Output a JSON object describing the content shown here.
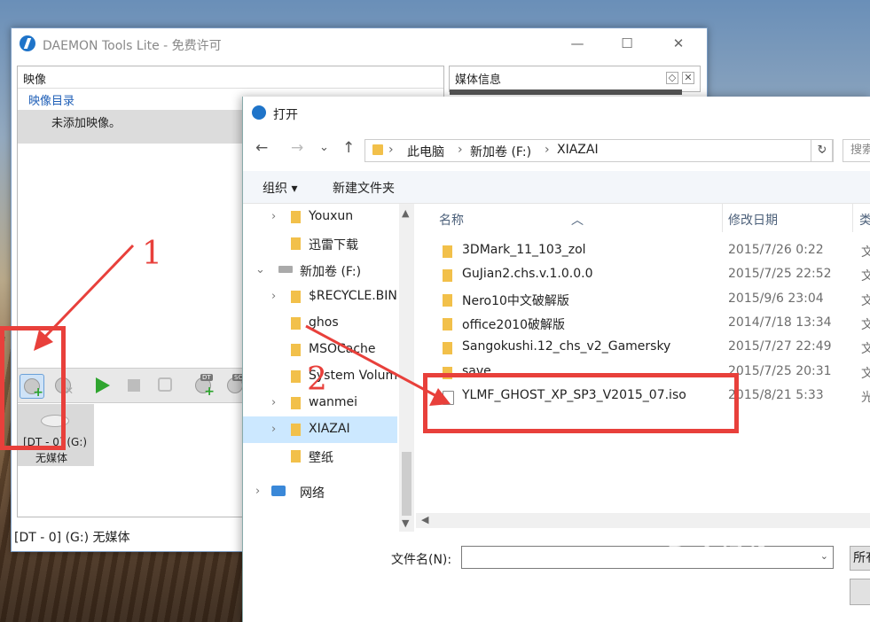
{
  "daemon": {
    "title": "DAEMON Tools Lite - 免费许可",
    "controls": {
      "minimize": "—",
      "maximize": "☐",
      "close": "✕"
    },
    "images_panel": {
      "header": "映像",
      "category": "映像目录",
      "empty_text": "未添加映像。"
    },
    "media_panel": {
      "header": "媒体信息"
    },
    "toolbar": {
      "dt_badge": "DT",
      "scsi_badge": "SCSI"
    },
    "drive": {
      "line1": "[DT - 0]  (G:)",
      "line2": "无媒体"
    },
    "status": "[DT - 0] (G:) 无媒体"
  },
  "open_dialog": {
    "title": "打开",
    "nav": {
      "back": "←",
      "forward": "→",
      "recent": "⌄",
      "up": "↑"
    },
    "breadcrumb": [
      "此电脑",
      "新加卷 (F:)",
      "XIAZAI"
    ],
    "search_placeholder": "搜索",
    "commands": {
      "organize": "组织 ▾",
      "new_folder": "新建文件夹"
    },
    "tree": [
      {
        "label": "Youxun",
        "expandable": true
      },
      {
        "label": "迅雷下载",
        "expandable": false
      },
      {
        "label": "新加卷 (F:)",
        "expandable": true,
        "expanded": true,
        "drive": true
      },
      {
        "label": "$RECYCLE.BIN",
        "expandable": true
      },
      {
        "label": "ghos",
        "expandable": false
      },
      {
        "label": "MSOCache",
        "expandable": false
      },
      {
        "label": "System Volum",
        "expandable": false
      },
      {
        "label": "wanmei",
        "expandable": true
      },
      {
        "label": "XIAZAI",
        "expandable": true,
        "selected": true
      },
      {
        "label": "壁纸",
        "expandable": false
      },
      {
        "label": "网络",
        "expandable": true,
        "network": true
      }
    ],
    "columns": {
      "name": "名称",
      "date": "修改日期",
      "type": "类"
    },
    "files": [
      {
        "name": "3DMark_11_103_zol",
        "date": "2015/7/26 0:22",
        "type": "文",
        "kind": "folder"
      },
      {
        "name": "GuJian2.chs.v.1.0.0.0",
        "date": "2015/7/25 22:52",
        "type": "文",
        "kind": "folder"
      },
      {
        "name": "Nero10中文破解版",
        "date": "2015/9/6 23:04",
        "type": "文",
        "kind": "folder"
      },
      {
        "name": "office2010破解版",
        "date": "2014/7/18 13:34",
        "type": "文",
        "kind": "folder"
      },
      {
        "name": "Sangokushi.12_chs_v2_Gamersky",
        "date": "2015/7/27 22:49",
        "type": "文",
        "kind": "folder"
      },
      {
        "name": "save",
        "date": "2015/7/25 20:31",
        "type": "文",
        "kind": "folder"
      },
      {
        "name": "YLMF_GHOST_XP_SP3_V2015_07.iso",
        "date": "2015/8/21 5:33",
        "type": "光",
        "kind": "iso"
      }
    ],
    "filename_label": "文件名(N):",
    "filename_value": "",
    "open_button": "所有",
    "cancel_button": ""
  },
  "annotations": {
    "step1": "1",
    "step2": "2",
    "color": "#e8403b"
  },
  "watermark": {
    "brand": "Bai 经验",
    "url": "jingyan.baidu.com"
  }
}
